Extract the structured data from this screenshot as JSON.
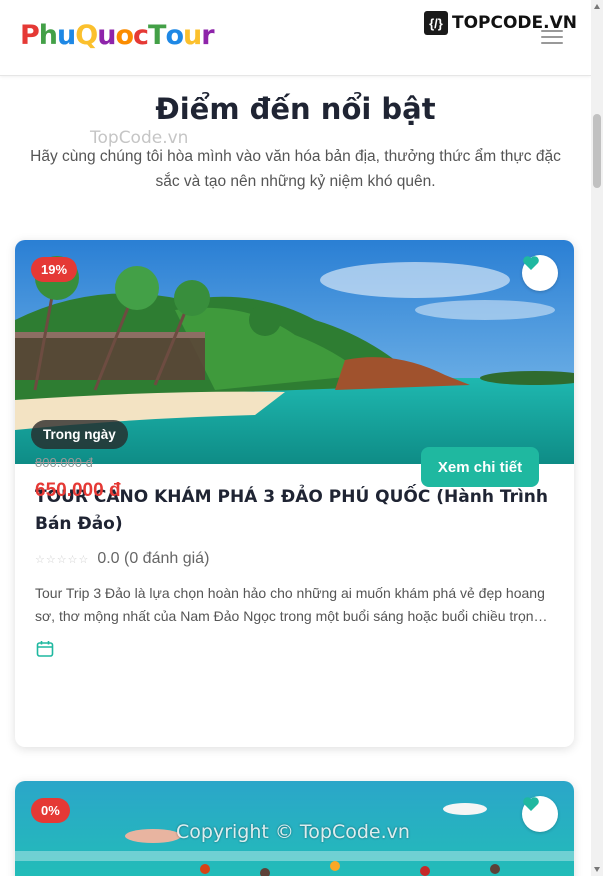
{
  "header": {
    "logo_letters": [
      "P",
      "h",
      "u",
      "Q",
      "u",
      "o",
      "c",
      "T",
      "o",
      "u",
      "r"
    ],
    "logo_colors": [
      "#e53935",
      "#43a047",
      "#1e88e5",
      "#fbc02d",
      "#8e24aa",
      "#fb8c00",
      "#e53935",
      "#43a047",
      "#1e88e5",
      "#fbc02d",
      "#8e24aa"
    ],
    "brand_mark": "{/}",
    "brand_name": "TOPCODE.VN",
    "menu_icon": "hamburger-icon"
  },
  "section": {
    "title": "Điểm đến nổi bật",
    "subtitle": "Hãy cùng chúng tôi hòa mình vào văn hóa bản địa, thưởng thức ẩm thực đặc sắc và tạo nên những kỷ niệm khó quên."
  },
  "watermarks": {
    "top": "TopCode.vn",
    "bottom": "Copyright © TopCode.vn"
  },
  "tours": [
    {
      "discount": "19%",
      "duration": "Trong ngày",
      "title": "TOUR CANO KHÁM PHÁ 3 ĐẢO PHÚ QUỐC (Hành Trình Bán Đảo)",
      "stars": "☆☆☆☆☆",
      "rating_text": "0.0 (0 đánh giá)",
      "description": "Tour Trip 3 Đảo là lựa chọn hoàn hảo cho những ai muốn khám phá vẻ đẹp hoang sơ, thơ mộng nhất của Nam Đảo Ngọc trong một buổi sáng hoặc buổi chiều trọn…",
      "old_price": "800.000 đ",
      "new_price": "650.000 đ",
      "button": "Xem chi tiết"
    },
    {
      "discount": "0%"
    }
  ],
  "colors": {
    "accent": "#1fb8a0",
    "discount": "#e53935",
    "price": "#e53935"
  }
}
